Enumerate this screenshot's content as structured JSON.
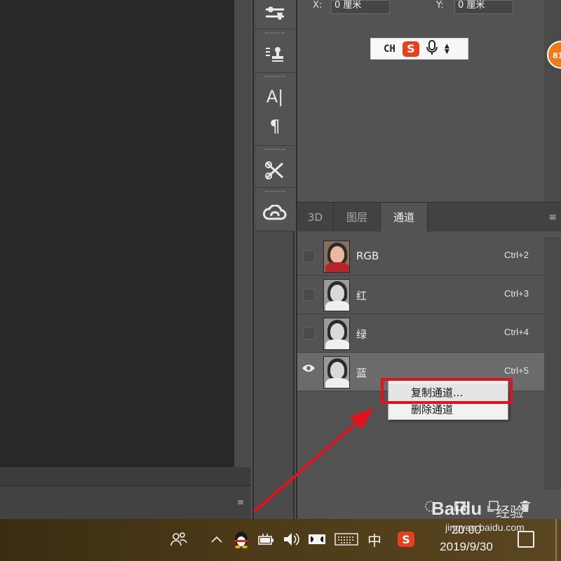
{
  "properties": {
    "x_label": "X:",
    "x_value": "0 厘米",
    "y_label": "Y:",
    "y_value": "0 厘米"
  },
  "ime": {
    "mode": "CH",
    "logo": "S"
  },
  "badge": {
    "text": "81",
    "color": "#f07a16"
  },
  "toolstrip": {
    "tools": [
      "properties-sliders-icon",
      "paths-stamp-icon",
      "character-icon",
      "paragraph-icon",
      "tools-icon",
      "creative-cloud-icon"
    ],
    "character_glyph": "A|",
    "paragraph_glyph": "¶"
  },
  "channels_panel": {
    "tabs": [
      {
        "label": "3D",
        "active": false
      },
      {
        "label": "图层",
        "active": false
      },
      {
        "label": "通道",
        "active": true
      }
    ],
    "menu_glyph": "≡",
    "channels": [
      {
        "name": "RGB",
        "shortcut": "Ctrl+2",
        "visible": false,
        "selected": false
      },
      {
        "name": "红",
        "shortcut": "Ctrl+3",
        "visible": false,
        "selected": false
      },
      {
        "name": "绿",
        "shortcut": "Ctrl+4",
        "visible": false,
        "selected": false
      },
      {
        "name": "蓝",
        "shortcut": "Ctrl+5",
        "visible": true,
        "selected": true
      }
    ]
  },
  "context_menu": {
    "items": [
      {
        "label": "复制通道...",
        "highlighted": true
      },
      {
        "label": "删除通道",
        "highlighted": false
      }
    ],
    "highlight_color": "#e3121a"
  },
  "canvas": {
    "menu_glyph": "≡"
  },
  "taskbar": {
    "ime_lang": "中",
    "sogou": "S",
    "time": "20:00",
    "date": "2019/9/30"
  },
  "watermark": {
    "brand": "Baidu",
    "brand_cn": "经验",
    "url": "jingyan.baidu.com"
  }
}
